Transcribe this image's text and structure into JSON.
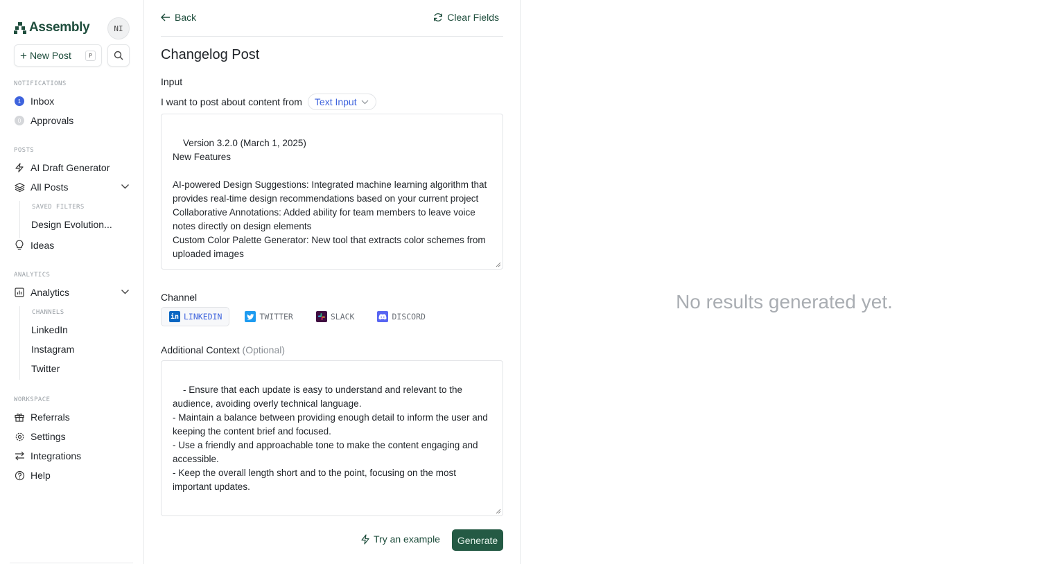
{
  "brand": {
    "name": "Assembly",
    "color": "#1e4d3c"
  },
  "user": {
    "initials": "NI"
  },
  "sidebar": {
    "new_post_label": "New Post",
    "new_post_shortcut": "P",
    "notifications_label": "NOTIFICATIONS",
    "inbox": {
      "label": "Inbox",
      "count": "1"
    },
    "approvals": {
      "label": "Approvals",
      "count": "0"
    },
    "posts_label": "POSTS",
    "ai_draft_label": "AI Draft Generator",
    "all_posts_label": "All Posts",
    "saved_filters_label": "SAVED FILTERS",
    "saved_filter_1": "Design Evolution...",
    "ideas_label": "Ideas",
    "analytics_section_label": "ANALYTICS",
    "analytics_label": "Analytics",
    "channels_label": "CHANNELS",
    "channel_1": "LinkedIn",
    "channel_2": "Instagram",
    "channel_3": "Twitter",
    "workspace_label": "WORKSPACE",
    "referrals_label": "Referrals",
    "settings_label": "Settings",
    "integrations_label": "Integrations",
    "help_label": "Help"
  },
  "editor": {
    "back_label": "Back",
    "clear_label": "Clear Fields",
    "title": "Changelog Post",
    "input_label": "Input",
    "post_from_text": "I want to post about content from",
    "source_select": "Text Input",
    "input_text": "Version 3.2.0 (March 1, 2025)\nNew Features\n\nAI-powered Design Suggestions: Integrated machine learning algorithm that provides real-time design recommendations based on your current project\nCollaborative Annotations: Added ability for team members to leave voice notes directly on design elements\nCustom Color Palette Generator: New tool that extracts color schemes from uploaded images",
    "channel_label": "Channel",
    "channels": {
      "linkedin": "LINKEDIN",
      "twitter": "TWITTER",
      "slack": "SLACK",
      "discord": "DISCORD"
    },
    "context_label": "Additional Context",
    "context_optional": "(Optional)",
    "context_text": "- Ensure that each update is easy to understand and relevant to the audience, avoiding overly technical language.\n- Maintain a balance between providing enough detail to inform the user and keeping the content brief and focused.\n- Use a friendly and approachable tone to make the content engaging and accessible.\n- Keep the overall length short and to the point, focusing on the most important updates.",
    "try_example_label": "Try an example",
    "generate_label": "Generate"
  },
  "results": {
    "empty_text": "No results generated yet."
  }
}
